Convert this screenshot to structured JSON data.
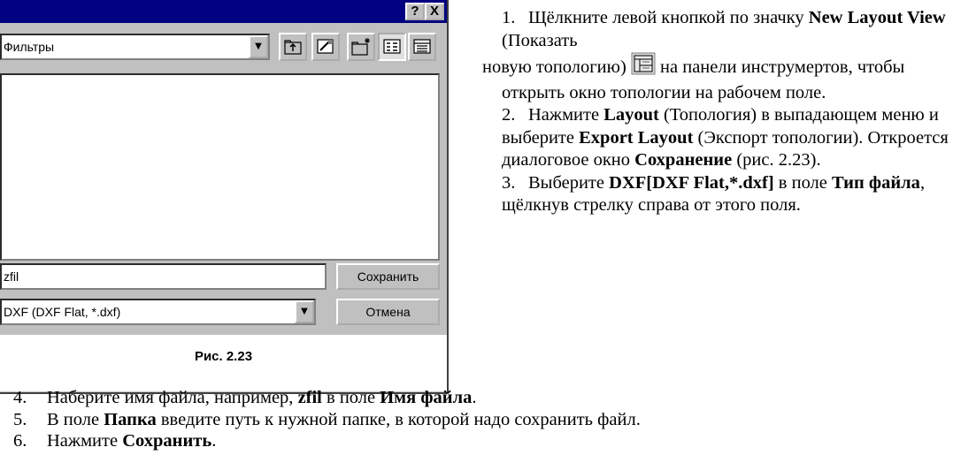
{
  "dialog": {
    "help_btn": "?",
    "close_btn": "X",
    "folder_value": "Фильтры",
    "filename_value": "zfil",
    "filetype_value": "DXF (DXF Flat, *.dxf)",
    "save_label": "Сохранить",
    "cancel_label": "Отмена",
    "figure_caption": "Рис. 2.23"
  },
  "instructions": {
    "s1_num": "1.",
    "s1_a": "Щёлкните левой кнопкой по значку ",
    "s1_b": "New Layout View",
    "s1_c": " (Показать",
    "s1_d": "новую топологию) ",
    "s1_e": " на панели инструмертов, чтобы открыть окно топологии на рабочем поле.",
    "s2_num": "2.",
    "s2_a": "Нажмите ",
    "s2_b": "Layout",
    "s2_c": " (Топология) в выпадающем меню и выберите ",
    "s2_d": "Export Layout",
    "s2_e": " (Экспорт топологии). Откроется диалоговое окно ",
    "s2_f": "Сохранение",
    "s2_g": " (рис. 2.23).",
    "s3_num": "3.",
    "s3_a": "Выберите ",
    "s3_b": "DXF[DXF Flat,*.dxf]",
    "s3_c": " в поле ",
    "s3_d": "Тип файла",
    "s3_e": ", щёлкнув стрелку справа от этого поля.",
    "s4_num": "4.",
    "s4_a": "Наберите имя файла, например, ",
    "s4_b": "zfil",
    "s4_c": " в поле ",
    "s4_d": "Имя файла",
    "s4_e": ".",
    "s5_num": "5.",
    "s5_a": "В поле ",
    "s5_b": "Папка",
    "s5_c": " введите путь к нужной папке, в которой надо сохранить файл.",
    "s6_num": "6.",
    "s6_a": "Нажмите ",
    "s6_b": "Сохранить",
    "s6_c": "."
  },
  "colors": {
    "titlebar": "#000080",
    "dialog_face": "#c0c0c0"
  }
}
